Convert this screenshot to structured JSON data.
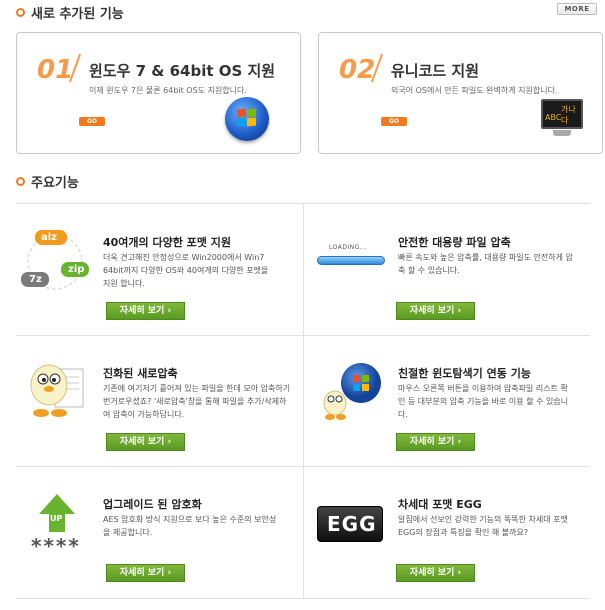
{
  "new_features": {
    "section_title": "새로 추가된 기능",
    "more_label": "MORE",
    "cards": [
      {
        "num": "01",
        "title": "윈도우 7 & 64bit OS 지원",
        "desc": "이제 윈도우 7은 물론 64bit OS도 지원합니다.",
        "go": "GO"
      },
      {
        "num": "02",
        "title": "유니코드 지원",
        "desc": "외국어 OS에서 만든 파일도 완벽하게 지원합니다.",
        "go": "GO",
        "screen_text_1": "ABC",
        "screen_text_2": "가나다"
      }
    ]
  },
  "main_features": {
    "section_title": "주요기능",
    "items": [
      {
        "title": "40여개의 다양한 포맷 지원",
        "desc": "더욱 견고해진 안정성으로 Win2000에서 Win7 64bit까지 다양한 OS와 40여개의 다양한 포맷을 지원 합니다.",
        "button": "자세히 보기 ›",
        "badges": [
          "alz",
          "zip",
          "7z"
        ]
      },
      {
        "title": "안전한 대용량 파일 압축",
        "desc": "빠른 속도와 높은 압축률, 대용량 파일도 안전하게 압축 할 수 있습니다.",
        "button": "자세히 보기 ›",
        "loading": "LOADING..."
      },
      {
        "title": "진화된 새로압축",
        "desc": "기존에 여기저기 흩어져 있는 파일을 한데 모아 압축하기 번거로우셨죠? '새로압축'창을 통해 파일을 추가/삭제하여 압축이 가능하답니다.",
        "button": "자세히 보기 ›"
      },
      {
        "title": "친절한 윈도탐색기 연동 기능",
        "desc": "마우스 오른쪽 버튼을 이용하여 압축파일 리스트 확인 등 대부분의 압축 기능을 바로 이용 할 수 있습니다.",
        "button": "자세히 보기 ›"
      },
      {
        "title": "업그레이드 된 암호화",
        "desc": "AES 암호화 방식 지원으로 보다 높은 수준의 보안성을 제공합니다.",
        "button": "자세히 보기 ›",
        "up": "UP",
        "stars": "****"
      },
      {
        "title": "차세대 포맷 EGG",
        "desc": "알집에서 선보인 강력한 기능의 똑똑한 차세대 포맷 EGG의 장점과 특징을 확인 해 볼까요?",
        "button": "자세히 보기 ›",
        "egg": "EGG"
      }
    ]
  },
  "colors": {
    "accent": "#f07a1e",
    "green_button": "#6aa82c",
    "win_blue": "#1e5ec9"
  }
}
